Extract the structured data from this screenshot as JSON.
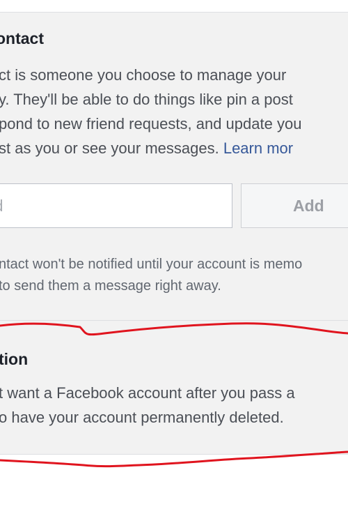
{
  "legacy_contact": {
    "title": "ontact",
    "description_lines": [
      "ct is someone you choose to manage your",
      "y. They'll be able to do things like pin a post",
      "pond to new friend requests, and update you",
      "st as you or see your messages. "
    ],
    "learn_more": "Learn mor",
    "input_placeholder": "iend",
    "add_label": "Add",
    "note_lines": [
      "ntact won't be notified until your account is memo",
      "to send them a message right away."
    ]
  },
  "deletion": {
    "title": "tion",
    "description_lines": [
      "t want a Facebook account after you pass a",
      "o have your account permanently deleted."
    ]
  },
  "colors": {
    "link": "#365899",
    "annotation_red": "#e0141e",
    "panel_bg": "#f2f2f2"
  }
}
